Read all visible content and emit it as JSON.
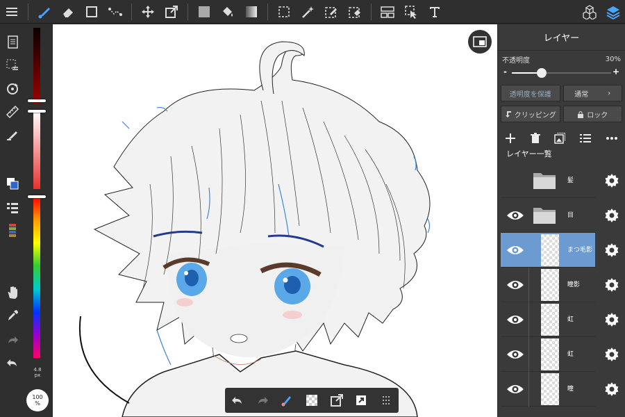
{
  "panel": {
    "title": "レイヤー",
    "opacity_label": "不透明度",
    "opacity_value": "30%",
    "opacity_fraction": 0.3,
    "minus": "-",
    "plus": "+",
    "protect_alpha": "透明度を保護",
    "blend_mode": "通常",
    "clipping": "クリッピング",
    "lock": "ロック",
    "layer_list_title": "レイヤー一覧",
    "layers": [
      {
        "name": "髪",
        "type": "folder",
        "visible": false,
        "selected": false
      },
      {
        "name": "目",
        "type": "folder",
        "visible": true,
        "selected": false
      },
      {
        "name": "まつ毛影",
        "type": "layer",
        "visible": true,
        "selected": true
      },
      {
        "name": "瞳影",
        "type": "layer",
        "visible": true,
        "selected": false
      },
      {
        "name": "虹",
        "type": "layer",
        "visible": true,
        "selected": false
      },
      {
        "name": "虹",
        "type": "layer",
        "visible": true,
        "selected": false
      },
      {
        "name": "瞳",
        "type": "layer",
        "visible": true,
        "selected": false
      }
    ]
  },
  "brush": {
    "size_label": "100\n%",
    "size_top": "4.8",
    "size_unit": "px"
  },
  "colors": {
    "accent": "#6b9bd1",
    "panel_bg": "#3a3a3a",
    "toolbar_bg": "#2f2f2f",
    "active_brush": "#4aa3ff",
    "current_color": "#2f64c8"
  }
}
